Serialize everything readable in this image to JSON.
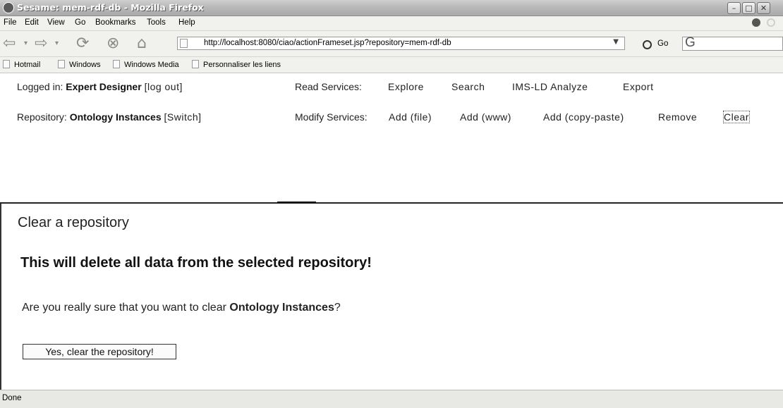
{
  "window": {
    "title": "Sesame: mem-rdf-db - Mozilla Firefox",
    "minimize": "–",
    "maximize": "□",
    "close": "✕"
  },
  "menu": [
    "File",
    "Edit",
    "View",
    "Go",
    "Bookmarks",
    "Tools",
    "Help"
  ],
  "nav": {
    "url": "http://localhost:8080/ciao/actionFrameset.jsp?repository=mem-rdf-db",
    "go_label": "Go",
    "search_placeholder": "G"
  },
  "bookmarks": [
    "Hotmail",
    "Windows",
    "Windows Media",
    "Personnaliser les liens"
  ],
  "header": {
    "logged_in_label": "Logged in:",
    "user": "Expert Designer",
    "logout": "[log out]",
    "repository_label": "Repository:",
    "repository": "Ontology Instances",
    "switch": "[Switch]",
    "read_label": "Read Services:",
    "read_links": [
      "Explore",
      "Search",
      "IMS-LD Analyze",
      "Export"
    ],
    "modify_label": "Modify Services:",
    "modify_links": [
      "Add (file)",
      "Add (www)",
      "Add (copy-paste)",
      "Remove",
      "Clear"
    ]
  },
  "main": {
    "title": "Clear a repository",
    "warning": "This will delete all data from the selected repository!",
    "question_prefix": "Are you really sure that you want to clear",
    "question_repo": "Ontology Instances",
    "question_suffix": "?",
    "confirm_button": "Yes, clear the repository!"
  },
  "status": "Done"
}
